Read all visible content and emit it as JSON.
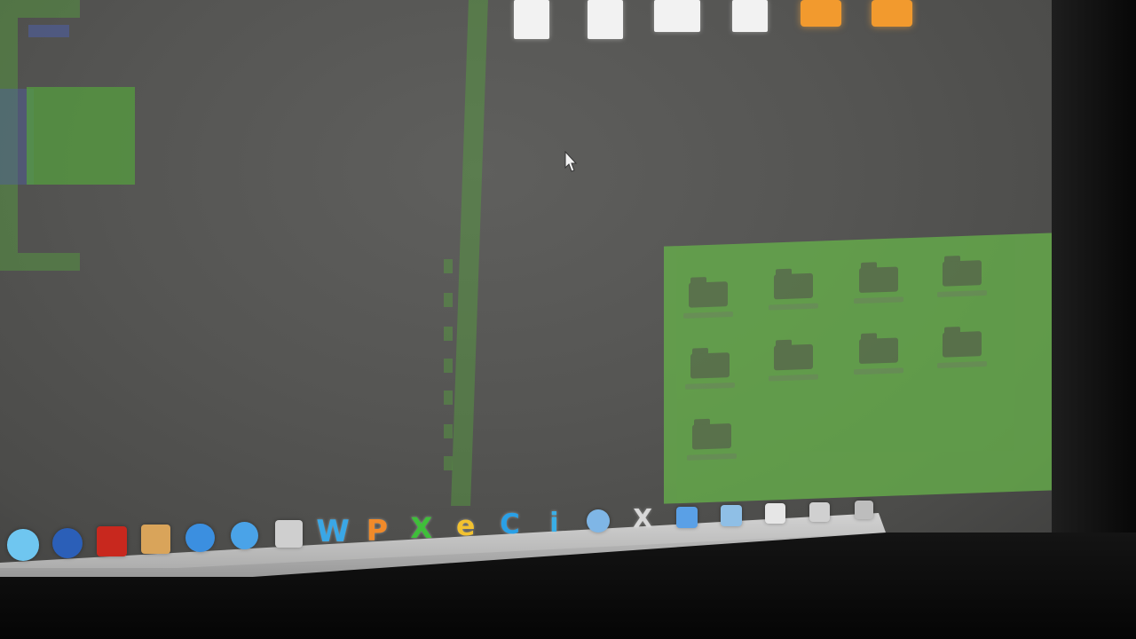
{
  "desktop": {
    "file_icons": [
      {
        "label": "",
        "kind": "document"
      },
      {
        "label": "",
        "kind": "document"
      },
      {
        "label": "",
        "kind": "document"
      },
      {
        "label": "",
        "kind": "document"
      },
      {
        "label": "",
        "kind": "package"
      },
      {
        "label": "",
        "kind": "package"
      }
    ]
  },
  "folder_window": {
    "folders": [
      {
        "label": ""
      },
      {
        "label": ""
      },
      {
        "label": ""
      },
      {
        "label": ""
      },
      {
        "label": ""
      },
      {
        "label": ""
      },
      {
        "label": ""
      },
      {
        "label": ""
      },
      {
        "label": ""
      }
    ]
  },
  "dock": {
    "items": [
      {
        "name": "finder-icon"
      },
      {
        "name": "dashboard-icon"
      },
      {
        "name": "mail-icon"
      },
      {
        "name": "photo-icon"
      },
      {
        "name": "safari-icon"
      },
      {
        "name": "itunes-icon"
      },
      {
        "name": "preview-icon"
      },
      {
        "name": "word-icon",
        "glyph": "W",
        "color": "#3aa7e6"
      },
      {
        "name": "powerpoint-icon",
        "glyph": "P",
        "color": "#f08a2a"
      },
      {
        "name": "excel-icon",
        "glyph": "X",
        "color": "#3fbf3a"
      },
      {
        "name": "entourage-icon",
        "glyph": "e",
        "color": "#f2c230"
      },
      {
        "name": "messenger-icon",
        "glyph": "C",
        "color": "#2aa0e6"
      },
      {
        "name": "app-icon",
        "glyph": "i",
        "color": "#3aaee6"
      },
      {
        "name": "network-icon"
      },
      {
        "name": "x11-icon",
        "glyph": "X",
        "color": "#d8d8d8"
      },
      {
        "name": "folder-stack-icon"
      },
      {
        "name": "folder-icon"
      },
      {
        "name": "document-stack-icon"
      },
      {
        "name": "downloads-icon"
      },
      {
        "name": "trash-icon"
      }
    ]
  },
  "colors": {
    "desktop_bg": "#555553",
    "ghost_green": "#56a23d",
    "folder_window_bg": "#66b04a",
    "dock_shelf": "#e0e0e0"
  }
}
